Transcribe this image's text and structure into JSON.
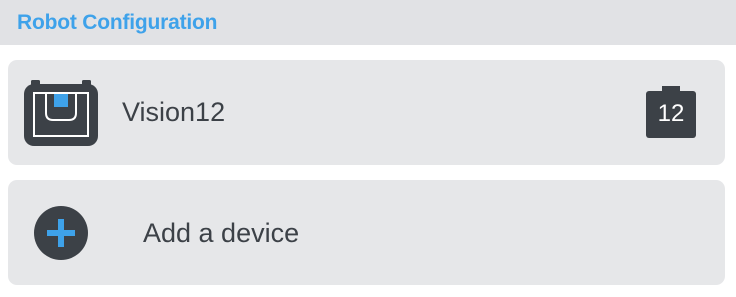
{
  "header": {
    "title": "Robot Configuration"
  },
  "devices": [
    {
      "name": "Vision12",
      "icon": "vision-sensor-icon",
      "port": "12"
    }
  ],
  "add_device": {
    "label": "Add a device",
    "icon": "plus-icon"
  },
  "colors": {
    "accent": "#3ea2ea",
    "header_bg": "#e1e2e5",
    "card_bg": "#e6e7e9",
    "dark": "#3c4147"
  }
}
